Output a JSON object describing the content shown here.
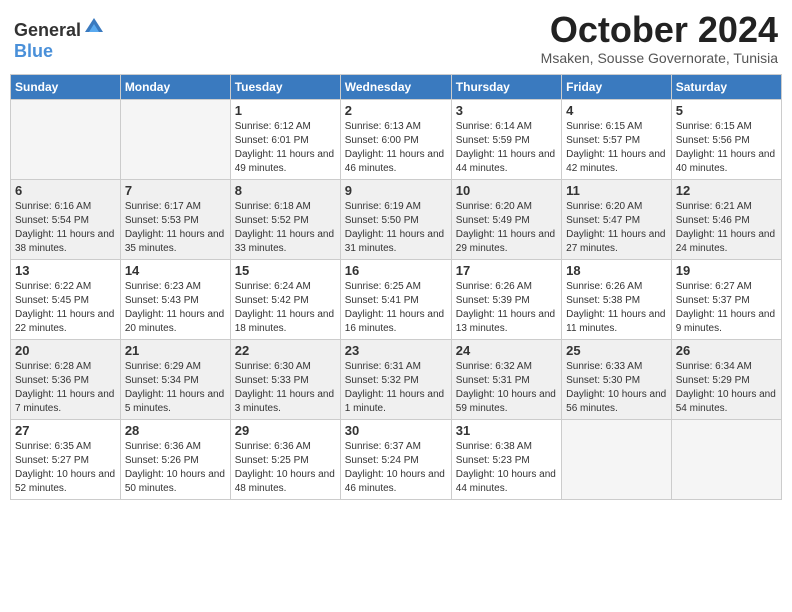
{
  "header": {
    "logo_general": "General",
    "logo_blue": "Blue",
    "month": "October 2024",
    "location": "Msaken, Sousse Governorate, Tunisia"
  },
  "weekdays": [
    "Sunday",
    "Monday",
    "Tuesday",
    "Wednesday",
    "Thursday",
    "Friday",
    "Saturday"
  ],
  "weeks": [
    [
      {
        "day": "",
        "sunrise": "",
        "sunset": "",
        "daylight": "",
        "empty": true
      },
      {
        "day": "",
        "sunrise": "",
        "sunset": "",
        "daylight": "",
        "empty": true
      },
      {
        "day": "1",
        "sunrise": "Sunrise: 6:12 AM",
        "sunset": "Sunset: 6:01 PM",
        "daylight": "Daylight: 11 hours and 49 minutes.",
        "empty": false
      },
      {
        "day": "2",
        "sunrise": "Sunrise: 6:13 AM",
        "sunset": "Sunset: 6:00 PM",
        "daylight": "Daylight: 11 hours and 46 minutes.",
        "empty": false
      },
      {
        "day": "3",
        "sunrise": "Sunrise: 6:14 AM",
        "sunset": "Sunset: 5:59 PM",
        "daylight": "Daylight: 11 hours and 44 minutes.",
        "empty": false
      },
      {
        "day": "4",
        "sunrise": "Sunrise: 6:15 AM",
        "sunset": "Sunset: 5:57 PM",
        "daylight": "Daylight: 11 hours and 42 minutes.",
        "empty": false
      },
      {
        "day": "5",
        "sunrise": "Sunrise: 6:15 AM",
        "sunset": "Sunset: 5:56 PM",
        "daylight": "Daylight: 11 hours and 40 minutes.",
        "empty": false
      }
    ],
    [
      {
        "day": "6",
        "sunrise": "Sunrise: 6:16 AM",
        "sunset": "Sunset: 5:54 PM",
        "daylight": "Daylight: 11 hours and 38 minutes.",
        "empty": false
      },
      {
        "day": "7",
        "sunrise": "Sunrise: 6:17 AM",
        "sunset": "Sunset: 5:53 PM",
        "daylight": "Daylight: 11 hours and 35 minutes.",
        "empty": false
      },
      {
        "day": "8",
        "sunrise": "Sunrise: 6:18 AM",
        "sunset": "Sunset: 5:52 PM",
        "daylight": "Daylight: 11 hours and 33 minutes.",
        "empty": false
      },
      {
        "day": "9",
        "sunrise": "Sunrise: 6:19 AM",
        "sunset": "Sunset: 5:50 PM",
        "daylight": "Daylight: 11 hours and 31 minutes.",
        "empty": false
      },
      {
        "day": "10",
        "sunrise": "Sunrise: 6:20 AM",
        "sunset": "Sunset: 5:49 PM",
        "daylight": "Daylight: 11 hours and 29 minutes.",
        "empty": false
      },
      {
        "day": "11",
        "sunrise": "Sunrise: 6:20 AM",
        "sunset": "Sunset: 5:47 PM",
        "daylight": "Daylight: 11 hours and 27 minutes.",
        "empty": false
      },
      {
        "day": "12",
        "sunrise": "Sunrise: 6:21 AM",
        "sunset": "Sunset: 5:46 PM",
        "daylight": "Daylight: 11 hours and 24 minutes.",
        "empty": false
      }
    ],
    [
      {
        "day": "13",
        "sunrise": "Sunrise: 6:22 AM",
        "sunset": "Sunset: 5:45 PM",
        "daylight": "Daylight: 11 hours and 22 minutes.",
        "empty": false
      },
      {
        "day": "14",
        "sunrise": "Sunrise: 6:23 AM",
        "sunset": "Sunset: 5:43 PM",
        "daylight": "Daylight: 11 hours and 20 minutes.",
        "empty": false
      },
      {
        "day": "15",
        "sunrise": "Sunrise: 6:24 AM",
        "sunset": "Sunset: 5:42 PM",
        "daylight": "Daylight: 11 hours and 18 minutes.",
        "empty": false
      },
      {
        "day": "16",
        "sunrise": "Sunrise: 6:25 AM",
        "sunset": "Sunset: 5:41 PM",
        "daylight": "Daylight: 11 hours and 16 minutes.",
        "empty": false
      },
      {
        "day": "17",
        "sunrise": "Sunrise: 6:26 AM",
        "sunset": "Sunset: 5:39 PM",
        "daylight": "Daylight: 11 hours and 13 minutes.",
        "empty": false
      },
      {
        "day": "18",
        "sunrise": "Sunrise: 6:26 AM",
        "sunset": "Sunset: 5:38 PM",
        "daylight": "Daylight: 11 hours and 11 minutes.",
        "empty": false
      },
      {
        "day": "19",
        "sunrise": "Sunrise: 6:27 AM",
        "sunset": "Sunset: 5:37 PM",
        "daylight": "Daylight: 11 hours and 9 minutes.",
        "empty": false
      }
    ],
    [
      {
        "day": "20",
        "sunrise": "Sunrise: 6:28 AM",
        "sunset": "Sunset: 5:36 PM",
        "daylight": "Daylight: 11 hours and 7 minutes.",
        "empty": false
      },
      {
        "day": "21",
        "sunrise": "Sunrise: 6:29 AM",
        "sunset": "Sunset: 5:34 PM",
        "daylight": "Daylight: 11 hours and 5 minutes.",
        "empty": false
      },
      {
        "day": "22",
        "sunrise": "Sunrise: 6:30 AM",
        "sunset": "Sunset: 5:33 PM",
        "daylight": "Daylight: 11 hours and 3 minutes.",
        "empty": false
      },
      {
        "day": "23",
        "sunrise": "Sunrise: 6:31 AM",
        "sunset": "Sunset: 5:32 PM",
        "daylight": "Daylight: 11 hours and 1 minute.",
        "empty": false
      },
      {
        "day": "24",
        "sunrise": "Sunrise: 6:32 AM",
        "sunset": "Sunset: 5:31 PM",
        "daylight": "Daylight: 10 hours and 59 minutes.",
        "empty": false
      },
      {
        "day": "25",
        "sunrise": "Sunrise: 6:33 AM",
        "sunset": "Sunset: 5:30 PM",
        "daylight": "Daylight: 10 hours and 56 minutes.",
        "empty": false
      },
      {
        "day": "26",
        "sunrise": "Sunrise: 6:34 AM",
        "sunset": "Sunset: 5:29 PM",
        "daylight": "Daylight: 10 hours and 54 minutes.",
        "empty": false
      }
    ],
    [
      {
        "day": "27",
        "sunrise": "Sunrise: 6:35 AM",
        "sunset": "Sunset: 5:27 PM",
        "daylight": "Daylight: 10 hours and 52 minutes.",
        "empty": false
      },
      {
        "day": "28",
        "sunrise": "Sunrise: 6:36 AM",
        "sunset": "Sunset: 5:26 PM",
        "daylight": "Daylight: 10 hours and 50 minutes.",
        "empty": false
      },
      {
        "day": "29",
        "sunrise": "Sunrise: 6:36 AM",
        "sunset": "Sunset: 5:25 PM",
        "daylight": "Daylight: 10 hours and 48 minutes.",
        "empty": false
      },
      {
        "day": "30",
        "sunrise": "Sunrise: 6:37 AM",
        "sunset": "Sunset: 5:24 PM",
        "daylight": "Daylight: 10 hours and 46 minutes.",
        "empty": false
      },
      {
        "day": "31",
        "sunrise": "Sunrise: 6:38 AM",
        "sunset": "Sunset: 5:23 PM",
        "daylight": "Daylight: 10 hours and 44 minutes.",
        "empty": false
      },
      {
        "day": "",
        "sunrise": "",
        "sunset": "",
        "daylight": "",
        "empty": true
      },
      {
        "day": "",
        "sunrise": "",
        "sunset": "",
        "daylight": "",
        "empty": true
      }
    ]
  ]
}
